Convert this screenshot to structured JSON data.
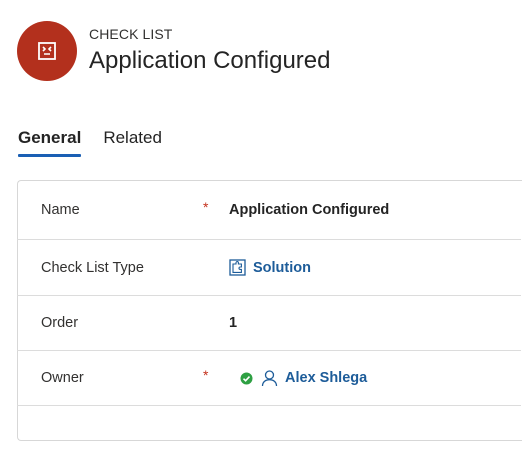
{
  "header": {
    "entity_kind": "CHECK LIST",
    "record_title": "Application Configured",
    "avatar_icon": "checklist-entity-icon",
    "avatar_color": "#b3301d"
  },
  "tabs": [
    {
      "label": "General",
      "active": true
    },
    {
      "label": "Related",
      "active": false
    }
  ],
  "form": {
    "fields": [
      {
        "label": "Name",
        "required": true,
        "value": "Application Configured"
      },
      {
        "label": "Check List Type",
        "required": false,
        "value": "Solution",
        "icon": "solution-puzzle-icon"
      },
      {
        "label": "Order",
        "required": false,
        "value": "1"
      },
      {
        "label": "Owner",
        "required": true,
        "value": "Alex Shlega",
        "status_icon": "available-status-icon",
        "icon": "person-icon"
      }
    ],
    "required_marker": "*"
  },
  "colors": {
    "accent": "#1a5fb4",
    "link": "#1d5c99",
    "required": "#c4311c",
    "presence_available": "#2ea043"
  }
}
